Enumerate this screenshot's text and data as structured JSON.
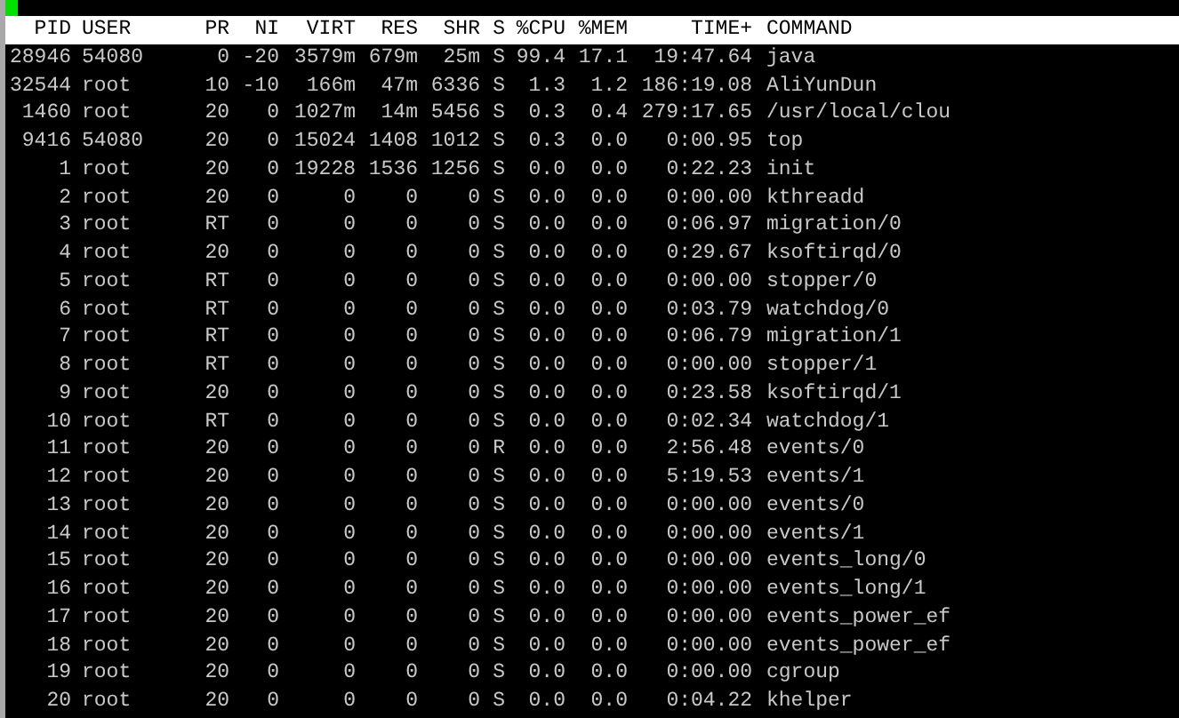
{
  "columns": [
    "PID",
    "USER",
    "PR",
    "NI",
    "VIRT",
    "RES",
    "SHR",
    "S",
    "%CPU",
    "%MEM",
    "TIME+",
    "COMMAND"
  ],
  "rows": [
    [
      "28946",
      "54080",
      "0",
      "-20",
      "3579m",
      "679m",
      "25m",
      "S",
      "99.4",
      "17.1",
      "19:47.64",
      "java"
    ],
    [
      "32544",
      "root",
      "10",
      "-10",
      "166m",
      "47m",
      "6336",
      "S",
      "1.3",
      "1.2",
      "186:19.08",
      "AliYunDun"
    ],
    [
      "1460",
      "root",
      "20",
      "0",
      "1027m",
      "14m",
      "5456",
      "S",
      "0.3",
      "0.4",
      "279:17.65",
      "/usr/local/clou"
    ],
    [
      "9416",
      "54080",
      "20",
      "0",
      "15024",
      "1408",
      "1012",
      "S",
      "0.3",
      "0.0",
      "0:00.95",
      "top"
    ],
    [
      "1",
      "root",
      "20",
      "0",
      "19228",
      "1536",
      "1256",
      "S",
      "0.0",
      "0.0",
      "0:22.23",
      "init"
    ],
    [
      "2",
      "root",
      "20",
      "0",
      "0",
      "0",
      "0",
      "S",
      "0.0",
      "0.0",
      "0:00.00",
      "kthreadd"
    ],
    [
      "3",
      "root",
      "RT",
      "0",
      "0",
      "0",
      "0",
      "S",
      "0.0",
      "0.0",
      "0:06.97",
      "migration/0"
    ],
    [
      "4",
      "root",
      "20",
      "0",
      "0",
      "0",
      "0",
      "S",
      "0.0",
      "0.0",
      "0:29.67",
      "ksoftirqd/0"
    ],
    [
      "5",
      "root",
      "RT",
      "0",
      "0",
      "0",
      "0",
      "S",
      "0.0",
      "0.0",
      "0:00.00",
      "stopper/0"
    ],
    [
      "6",
      "root",
      "RT",
      "0",
      "0",
      "0",
      "0",
      "S",
      "0.0",
      "0.0",
      "0:03.79",
      "watchdog/0"
    ],
    [
      "7",
      "root",
      "RT",
      "0",
      "0",
      "0",
      "0",
      "S",
      "0.0",
      "0.0",
      "0:06.79",
      "migration/1"
    ],
    [
      "8",
      "root",
      "RT",
      "0",
      "0",
      "0",
      "0",
      "S",
      "0.0",
      "0.0",
      "0:00.00",
      "stopper/1"
    ],
    [
      "9",
      "root",
      "20",
      "0",
      "0",
      "0",
      "0",
      "S",
      "0.0",
      "0.0",
      "0:23.58",
      "ksoftirqd/1"
    ],
    [
      "10",
      "root",
      "RT",
      "0",
      "0",
      "0",
      "0",
      "S",
      "0.0",
      "0.0",
      "0:02.34",
      "watchdog/1"
    ],
    [
      "11",
      "root",
      "20",
      "0",
      "0",
      "0",
      "0",
      "R",
      "0.0",
      "0.0",
      "2:56.48",
      "events/0"
    ],
    [
      "12",
      "root",
      "20",
      "0",
      "0",
      "0",
      "0",
      "S",
      "0.0",
      "0.0",
      "5:19.53",
      "events/1"
    ],
    [
      "13",
      "root",
      "20",
      "0",
      "0",
      "0",
      "0",
      "S",
      "0.0",
      "0.0",
      "0:00.00",
      "events/0"
    ],
    [
      "14",
      "root",
      "20",
      "0",
      "0",
      "0",
      "0",
      "S",
      "0.0",
      "0.0",
      "0:00.00",
      "events/1"
    ],
    [
      "15",
      "root",
      "20",
      "0",
      "0",
      "0",
      "0",
      "S",
      "0.0",
      "0.0",
      "0:00.00",
      "events_long/0"
    ],
    [
      "16",
      "root",
      "20",
      "0",
      "0",
      "0",
      "0",
      "S",
      "0.0",
      "0.0",
      "0:00.00",
      "events_long/1"
    ],
    [
      "17",
      "root",
      "20",
      "0",
      "0",
      "0",
      "0",
      "S",
      "0.0",
      "0.0",
      "0:00.00",
      "events_power_ef"
    ],
    [
      "18",
      "root",
      "20",
      "0",
      "0",
      "0",
      "0",
      "S",
      "0.0",
      "0.0",
      "0:00.00",
      "events_power_ef"
    ],
    [
      "19",
      "root",
      "20",
      "0",
      "0",
      "0",
      "0",
      "S",
      "0.0",
      "0.0",
      "0:00.00",
      "cgroup"
    ],
    [
      "20",
      "root",
      "20",
      "0",
      "0",
      "0",
      "0",
      "S",
      "0.0",
      "0.0",
      "0:04.22",
      "khelper"
    ]
  ]
}
